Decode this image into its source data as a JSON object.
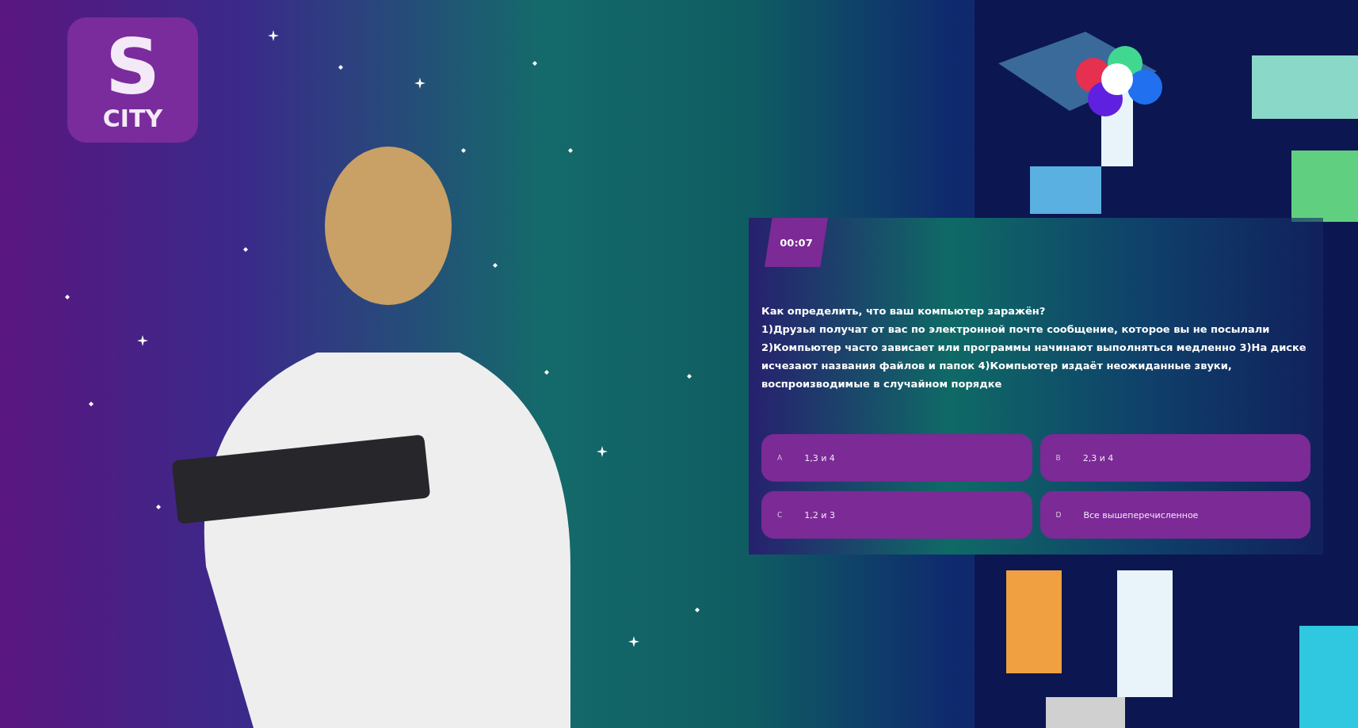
{
  "logo": {
    "letter": "S",
    "word": "CITY"
  },
  "quiz": {
    "timer": "00:07",
    "question": "Как определить, что ваш компьютер заражён?",
    "statement": "1)Друзья получат от вас по электронной почте сообщение, которое вы не посылали 2)Компьютер часто зависает или программы начинают выполняться медленно 3)На диске исчезают названия файлов и папок 4)Компьютер издаёт неожиданные звуки, воспроизводимые в случайном порядке",
    "options": [
      {
        "letter": "A",
        "text": "1,3 и 4"
      },
      {
        "letter": "B",
        "text": "2,3 и 4"
      },
      {
        "letter": "C",
        "text": "1,2 и 3"
      },
      {
        "letter": "D",
        "text": "Все вышеперечисленное"
      }
    ]
  }
}
